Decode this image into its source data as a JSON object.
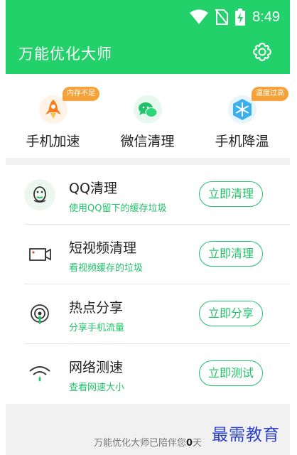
{
  "status_bar": {
    "time": "8:49"
  },
  "app_bar": {
    "title": "万能优化大师"
  },
  "quick_actions": [
    {
      "label": "手机加速",
      "badge": "内存不足",
      "icon": "rocket-icon"
    },
    {
      "label": "微信清理",
      "badge": "",
      "icon": "wechat-icon"
    },
    {
      "label": "手机降温",
      "badge": "温度过高",
      "icon": "snowflake-icon"
    }
  ],
  "tools": [
    {
      "title": "QQ清理",
      "subtitle": "使用QQ留下的缓存垃圾",
      "button": "立即清理",
      "icon": "qq-penguin-icon"
    },
    {
      "title": "短视频清理",
      "subtitle": "看视频缓存的垃圾",
      "button": "立即清理",
      "icon": "video-camera-icon"
    },
    {
      "title": "热点分享",
      "subtitle": "分享手机流量",
      "button": "立即分享",
      "icon": "hotspot-icon"
    },
    {
      "title": "网络测速",
      "subtitle": "查看网速大小",
      "button": "立即测试",
      "icon": "wifi-speed-icon"
    }
  ],
  "footer": {
    "prefix": "万能优化大师已陪伴您",
    "days": "0",
    "suffix": "天"
  },
  "watermark": "最需教育",
  "colors": {
    "brand_green": "#23d16b",
    "badge_orange": "#f6a23a",
    "watermark_blue": "#2a40c8"
  }
}
